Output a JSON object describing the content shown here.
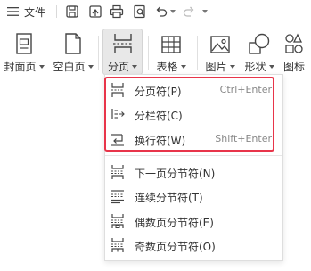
{
  "quick_bar": {
    "menu_label": "文件",
    "icons": [
      "save-icon",
      "export-icon",
      "print-icon",
      "print-preview-icon",
      "undo-icon",
      "redo-icon",
      "more-icon"
    ]
  },
  "ribbon": {
    "cover_label": "封面页",
    "blank_label": "空白页",
    "pagebreak_label": "分页",
    "table_label": "表格",
    "picture_label": "图片",
    "shape_label": "形状",
    "icon_label": "图标"
  },
  "dropdown": {
    "items": [
      {
        "label": "分页符(P)",
        "shortcut": "Ctrl+Enter"
      },
      {
        "label": "分栏符(C)",
        "shortcut": ""
      },
      {
        "label": "换行符(W)",
        "shortcut": "Shift+Enter"
      },
      {
        "label": "下一页分节符(N)",
        "shortcut": ""
      },
      {
        "label": "连续分节符(T)",
        "shortcut": ""
      },
      {
        "label": "偶数页分节符(E)",
        "shortcut": ""
      },
      {
        "label": "奇数页分节符(O)",
        "shortcut": ""
      }
    ]
  },
  "colors": {
    "highlight": "#e8354a",
    "active_bg": "#e8e8e8",
    "text": "#333333",
    "shortcut": "#888888"
  }
}
